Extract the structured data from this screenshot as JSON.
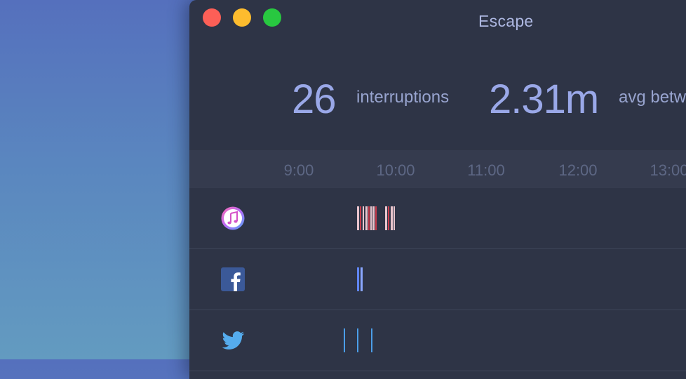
{
  "window": {
    "title": "Escape"
  },
  "stats": [
    {
      "value": "26",
      "label": "interruptions"
    },
    {
      "value": "2.31m",
      "label": "avg betw"
    }
  ],
  "timeline": {
    "ticks": [
      "9:00",
      "10:00",
      "11:00",
      "12:00",
      "13:00"
    ]
  },
  "apps": [
    {
      "name": "itunes-icon",
      "color": "#e8c4cc"
    },
    {
      "name": "facebook-icon",
      "color": "#5f85f6"
    },
    {
      "name": "twitter-icon",
      "color": "#4b9ee8"
    }
  ],
  "colors": {
    "window_bg": "#2e3446",
    "header_bg": "#353b4e",
    "accent": "#9aa8e8"
  }
}
